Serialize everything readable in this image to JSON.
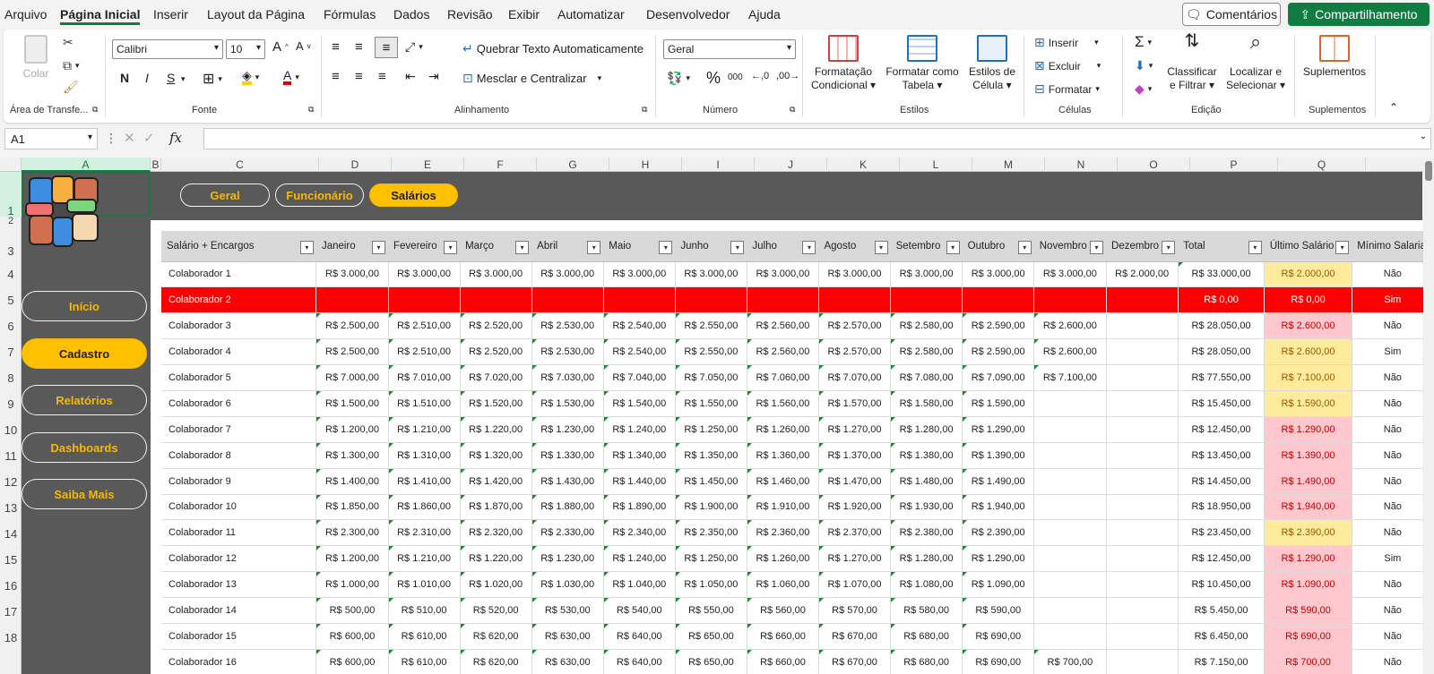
{
  "menu": {
    "items": [
      "Arquivo",
      "Página Inicial",
      "Inserir",
      "Layout da Página",
      "Fórmulas",
      "Dados",
      "Revisão",
      "Exibir",
      "Automatizar",
      "Desenvolvedor",
      "Ajuda"
    ],
    "comments": "Comentários",
    "share": "Compartilhamento"
  },
  "ribbon": {
    "clipboard": {
      "paste": "Colar",
      "label": "Área de Transfe..."
    },
    "font": {
      "name": "Calibri",
      "size": "10",
      "label": "Fonte",
      "bold": "N",
      "italic": "I",
      "underline": "S"
    },
    "alignment": {
      "wrap": "Quebrar Texto Automaticamente",
      "merge": "Mesclar e Centralizar",
      "label": "Alinhamento"
    },
    "number": {
      "format": "Geral",
      "percent": "%",
      "thousands": "000",
      "label": "Número"
    },
    "styles": {
      "conditional": [
        "Formatação",
        "Condicional"
      ],
      "table": [
        "Formatar como",
        "Tabela"
      ],
      "cell": [
        "Estilos de",
        "Célula"
      ],
      "label": "Estilos"
    },
    "cells": {
      "insert": "Inserir",
      "delete": "Excluir",
      "format": "Formatar",
      "label": "Células"
    },
    "editing": {
      "sort": [
        "Classificar",
        "e Filtrar"
      ],
      "find": [
        "Localizar e",
        "Selecionar"
      ],
      "label": "Edição"
    },
    "addins": {
      "btn": "Suplementos",
      "label": "Suplementos"
    }
  },
  "formula_bar": {
    "name_box": "A1",
    "fx": "fx",
    "value": ""
  },
  "columns": [
    "A",
    "B",
    "C",
    "D",
    "E",
    "F",
    "G",
    "H",
    "I",
    "J",
    "K",
    "L",
    "M",
    "N",
    "O",
    "P",
    "Q"
  ],
  "rows": [
    "1",
    "2",
    "3",
    "4",
    "5",
    "6",
    "7",
    "8",
    "9",
    "10",
    "11",
    "12",
    "13",
    "14",
    "15",
    "16",
    "17",
    "18"
  ],
  "top_tabs": [
    "Geral",
    "Funcionário",
    "Salários"
  ],
  "sidebar": [
    "Início",
    "Cadastro",
    "Relatórios",
    "Dashboards",
    "Saiba Mais"
  ],
  "colors": {
    "accent": "#ffc000",
    "green": "#107c41",
    "dark": "#595959",
    "red": "#ff0000"
  },
  "table": {
    "headers": [
      "Salário + Encargos",
      "Janeiro",
      "Fevereiro",
      "Março",
      "Abril",
      "Maio",
      "Junho",
      "Julho",
      "Agosto",
      "Setembro",
      "Outubro",
      "Novembro",
      "Dezembro",
      "Total",
      "Último Salário",
      "Mínimo Salarial"
    ],
    "rows": [
      {
        "c": [
          "Colaborador 1",
          "R$ 3.000,00",
          "R$ 3.000,00",
          "R$ 3.000,00",
          "R$ 3.000,00",
          "R$ 3.000,00",
          "R$ 3.000,00",
          "R$ 3.000,00",
          "R$ 3.000,00",
          "R$ 3.000,00",
          "R$ 3.000,00",
          "R$ 3.000,00",
          "R$ 2.000,00",
          "R$ 33.000,00",
          "R$ 2.000,00",
          "Não"
        ],
        "hl": "yellow"
      },
      {
        "c": [
          "Colaborador 2",
          "",
          "",
          "",
          "",
          "",
          "",
          "",
          "",
          "",
          "",
          "",
          "",
          "R$ 0,00",
          "R$ 0,00",
          "Sim"
        ],
        "hl": "red",
        "red": true
      },
      {
        "c": [
          "Colaborador 3",
          "R$ 2.500,00",
          "R$ 2.510,00",
          "R$ 2.520,00",
          "R$ 2.530,00",
          "R$ 2.540,00",
          "R$ 2.550,00",
          "R$ 2.560,00",
          "R$ 2.570,00",
          "R$ 2.580,00",
          "R$ 2.590,00",
          "R$ 2.600,00",
          "",
          "R$ 28.050,00",
          "R$ 2.600,00",
          "Não"
        ],
        "hl": "pink"
      },
      {
        "c": [
          "Colaborador 4",
          "R$ 2.500,00",
          "R$ 2.510,00",
          "R$ 2.520,00",
          "R$ 2.530,00",
          "R$ 2.540,00",
          "R$ 2.550,00",
          "R$ 2.560,00",
          "R$ 2.570,00",
          "R$ 2.580,00",
          "R$ 2.590,00",
          "R$ 2.600,00",
          "",
          "R$ 28.050,00",
          "R$ 2.600,00",
          "Sim"
        ],
        "hl": "yellow"
      },
      {
        "c": [
          "Colaborador 5",
          "R$ 7.000,00",
          "R$ 7.010,00",
          "R$ 7.020,00",
          "R$ 7.030,00",
          "R$ 7.040,00",
          "R$ 7.050,00",
          "R$ 7.060,00",
          "R$ 7.070,00",
          "R$ 7.080,00",
          "R$ 7.090,00",
          "R$ 7.100,00",
          "",
          "R$ 77.550,00",
          "R$ 7.100,00",
          "Não"
        ],
        "hl": "yellow"
      },
      {
        "c": [
          "Colaborador 6",
          "R$ 1.500,00",
          "R$ 1.510,00",
          "R$ 1.520,00",
          "R$ 1.530,00",
          "R$ 1.540,00",
          "R$ 1.550,00",
          "R$ 1.560,00",
          "R$ 1.570,00",
          "R$ 1.580,00",
          "R$ 1.590,00",
          "",
          "",
          "R$ 15.450,00",
          "R$ 1.590,00",
          "Não"
        ],
        "hl": "yellow"
      },
      {
        "c": [
          "Colaborador 7",
          "R$ 1.200,00",
          "R$ 1.210,00",
          "R$ 1.220,00",
          "R$ 1.230,00",
          "R$ 1.240,00",
          "R$ 1.250,00",
          "R$ 1.260,00",
          "R$ 1.270,00",
          "R$ 1.280,00",
          "R$ 1.290,00",
          "",
          "",
          "R$ 12.450,00",
          "R$ 1.290,00",
          "Não"
        ],
        "hl": "pink"
      },
      {
        "c": [
          "Colaborador 8",
          "R$ 1.300,00",
          "R$ 1.310,00",
          "R$ 1.320,00",
          "R$ 1.330,00",
          "R$ 1.340,00",
          "R$ 1.350,00",
          "R$ 1.360,00",
          "R$ 1.370,00",
          "R$ 1.380,00",
          "R$ 1.390,00",
          "",
          "",
          "R$ 13.450,00",
          "R$ 1.390,00",
          "Não"
        ],
        "hl": "pink"
      },
      {
        "c": [
          "Colaborador 9",
          "R$ 1.400,00",
          "R$ 1.410,00",
          "R$ 1.420,00",
          "R$ 1.430,00",
          "R$ 1.440,00",
          "R$ 1.450,00",
          "R$ 1.460,00",
          "R$ 1.470,00",
          "R$ 1.480,00",
          "R$ 1.490,00",
          "",
          "",
          "R$ 14.450,00",
          "R$ 1.490,00",
          "Não"
        ],
        "hl": "pink"
      },
      {
        "c": [
          "Colaborador 10",
          "R$ 1.850,00",
          "R$ 1.860,00",
          "R$ 1.870,00",
          "R$ 1.880,00",
          "R$ 1.890,00",
          "R$ 1.900,00",
          "R$ 1.910,00",
          "R$ 1.920,00",
          "R$ 1.930,00",
          "R$ 1.940,00",
          "",
          "",
          "R$ 18.950,00",
          "R$ 1.940,00",
          "Não"
        ],
        "hl": "pink"
      },
      {
        "c": [
          "Colaborador 11",
          "R$ 2.300,00",
          "R$ 2.310,00",
          "R$ 2.320,00",
          "R$ 2.330,00",
          "R$ 2.340,00",
          "R$ 2.350,00",
          "R$ 2.360,00",
          "R$ 2.370,00",
          "R$ 2.380,00",
          "R$ 2.390,00",
          "",
          "",
          "R$ 23.450,00",
          "R$ 2.390,00",
          "Não"
        ],
        "hl": "yellow"
      },
      {
        "c": [
          "Colaborador 12",
          "R$ 1.200,00",
          "R$ 1.210,00",
          "R$ 1.220,00",
          "R$ 1.230,00",
          "R$ 1.240,00",
          "R$ 1.250,00",
          "R$ 1.260,00",
          "R$ 1.270,00",
          "R$ 1.280,00",
          "R$ 1.290,00",
          "",
          "",
          "R$ 12.450,00",
          "R$ 1.290,00",
          "Sim"
        ],
        "hl": "pink"
      },
      {
        "c": [
          "Colaborador 13",
          "R$ 1.000,00",
          "R$ 1.010,00",
          "R$ 1.020,00",
          "R$ 1.030,00",
          "R$ 1.040,00",
          "R$ 1.050,00",
          "R$ 1.060,00",
          "R$ 1.070,00",
          "R$ 1.080,00",
          "R$ 1.090,00",
          "",
          "",
          "R$ 10.450,00",
          "R$ 1.090,00",
          "Não"
        ],
        "hl": "pink"
      },
      {
        "c": [
          "Colaborador 14",
          "R$ 500,00",
          "R$ 510,00",
          "R$ 520,00",
          "R$ 530,00",
          "R$ 540,00",
          "R$ 550,00",
          "R$ 560,00",
          "R$ 570,00",
          "R$ 580,00",
          "R$ 590,00",
          "",
          "",
          "R$ 5.450,00",
          "R$ 590,00",
          "Não"
        ],
        "hl": "pink"
      },
      {
        "c": [
          "Colaborador 15",
          "R$ 600,00",
          "R$ 610,00",
          "R$ 620,00",
          "R$ 630,00",
          "R$ 640,00",
          "R$ 650,00",
          "R$ 660,00",
          "R$ 670,00",
          "R$ 680,00",
          "R$ 690,00",
          "",
          "",
          "R$ 6.450,00",
          "R$ 690,00",
          "Não"
        ],
        "hl": "pink"
      },
      {
        "c": [
          "Colaborador 16",
          "R$ 600,00",
          "R$ 610,00",
          "R$ 620,00",
          "R$ 630,00",
          "R$ 640,00",
          "R$ 650,00",
          "R$ 660,00",
          "R$ 670,00",
          "R$ 680,00",
          "R$ 690,00",
          "R$ 700,00",
          "",
          "R$ 7.150,00",
          "R$ 700,00",
          "Não"
        ],
        "hl": "pink"
      }
    ]
  }
}
